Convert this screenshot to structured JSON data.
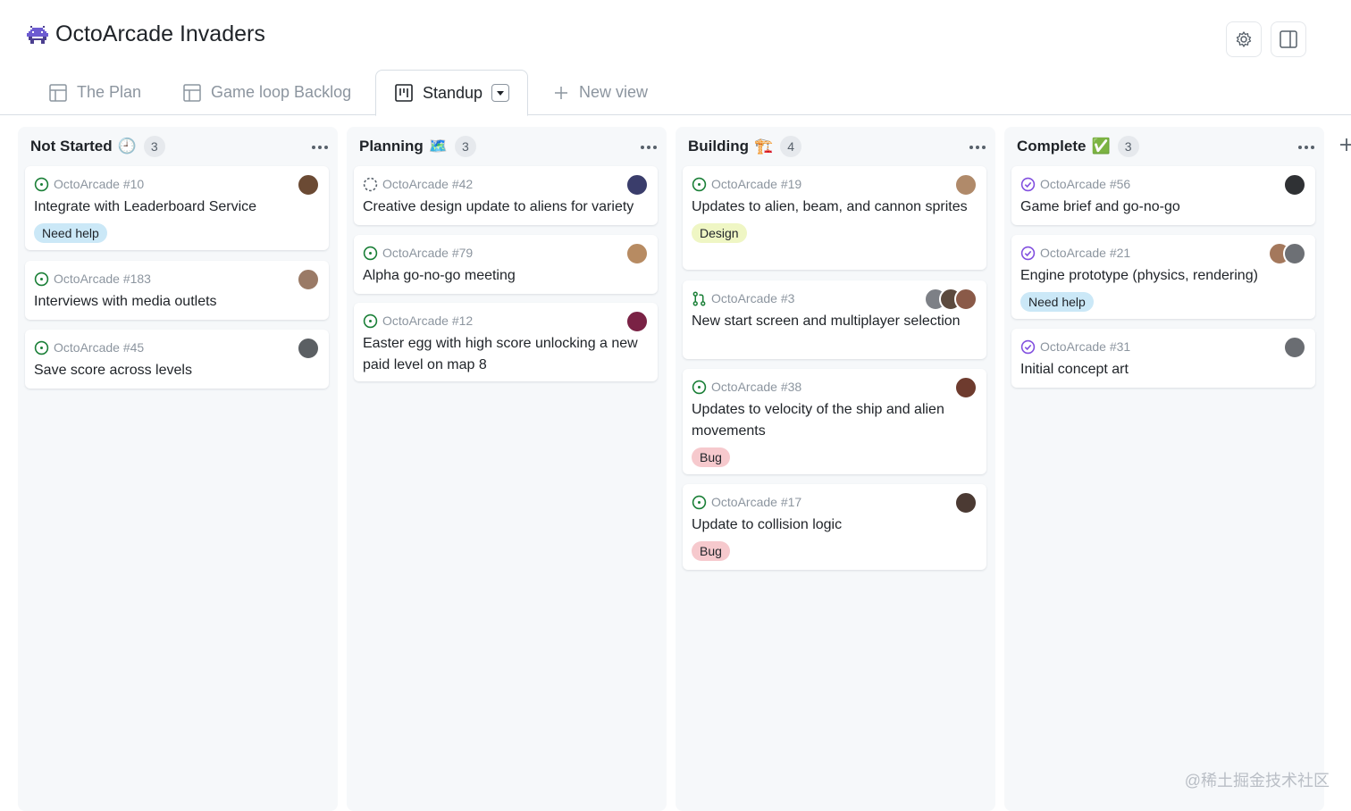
{
  "project": {
    "title": "OctoArcade Invaders"
  },
  "tabs": [
    {
      "label": "The Plan",
      "icon": "table-icon"
    },
    {
      "label": "Game loop Backlog",
      "icon": "table-icon"
    },
    {
      "label": "Standup",
      "icon": "board-icon",
      "active": true
    },
    {
      "label": "New view",
      "icon": "plus-icon"
    }
  ],
  "columns": [
    {
      "title": "Not Started",
      "emoji": "🕘",
      "count": "3",
      "cards": [
        {
          "ref": "OctoArcade #10",
          "title": "Integrate with Leaderboard Service",
          "label": "Need help",
          "status": "open",
          "avatars": [
            "#6b4a34"
          ]
        },
        {
          "ref": "OctoArcade #183",
          "title": "Interviews with media outlets",
          "status": "open",
          "avatars": [
            "#9a7a66"
          ]
        },
        {
          "ref": "OctoArcade #45",
          "title": "Save score across levels",
          "status": "open",
          "avatars": [
            "#5b5f63"
          ]
        }
      ]
    },
    {
      "title": "Planning",
      "emoji": "🗺️",
      "count": "3",
      "cards": [
        {
          "ref": "OctoArcade #42",
          "title": "Creative design update to aliens for variety",
          "status": "draft",
          "avatars": [
            "#3a3d6b"
          ]
        },
        {
          "ref": "OctoArcade #79",
          "title": "Alpha go-no-go meeting",
          "status": "open",
          "avatars": [
            "#b78b62"
          ]
        },
        {
          "ref": "OctoArcade #12",
          "title": "Easter egg with high score unlocking a new paid level on map 8",
          "status": "open",
          "avatars": [
            "#7a2245"
          ]
        }
      ]
    },
    {
      "title": "Building",
      "emoji": "🏗️",
      "count": "4",
      "cards": [
        {
          "ref": "OctoArcade #19",
          "title": "Updates to alien, beam, and cannon sprites",
          "label": "Design",
          "status": "open",
          "avatars": [
            "#b08a6a"
          ]
        },
        {
          "ref": "OctoArcade #3",
          "title": "New start screen and multiplayer selection",
          "status": "pr",
          "avatars": [
            "#7d8086",
            "#5c4a3e",
            "#8a5a48"
          ]
        },
        {
          "ref": "OctoArcade #38",
          "title": "Updates to velocity of the ship and alien movements",
          "label": "Bug",
          "status": "open",
          "avatars": [
            "#6e3b2e"
          ]
        },
        {
          "ref": "OctoArcade #17",
          "title": "Update to collision logic",
          "label": "Bug",
          "status": "open",
          "avatars": [
            "#4b3a33"
          ]
        }
      ]
    },
    {
      "title": "Complete",
      "emoji": "✅",
      "count": "3",
      "cards": [
        {
          "ref": "OctoArcade #56",
          "title": "Game brief and go-no-go",
          "status": "done",
          "avatars": [
            "#2f3134"
          ]
        },
        {
          "ref": "OctoArcade #21",
          "title": "Engine prototype (physics, rendering)",
          "label": "Need help",
          "status": "done",
          "avatars": [
            "#a4785c",
            "#6d7075"
          ]
        },
        {
          "ref": "OctoArcade #31",
          "title": "Initial concept art",
          "status": "done",
          "avatars": [
            "#6a6d72"
          ]
        }
      ]
    }
  ],
  "watermark": "@稀土掘金技术社区",
  "colors": {
    "open": "#1a7f37",
    "draft": "#57606a",
    "done": "#8250df",
    "pr": "#1a7f37"
  }
}
